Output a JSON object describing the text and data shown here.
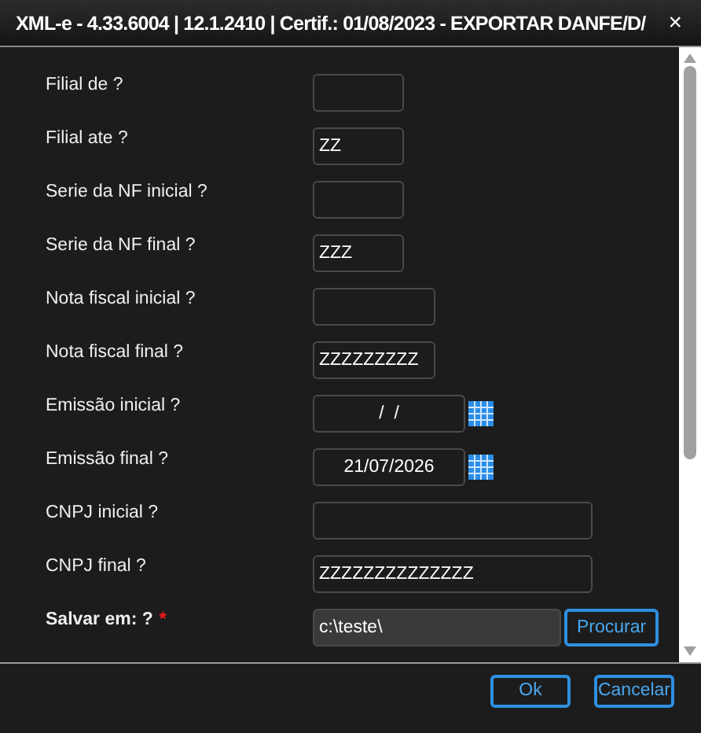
{
  "window": {
    "title": "XML-e - 4.33.6004 | 12.1.2410 | Certif.: 01/08/2023 - EXPORTAR DANFE/D/",
    "close": "×"
  },
  "fields": [
    {
      "label": "Filial de ?",
      "kind": "short"
    },
    {
      "label": "Filial ate ?",
      "kind": "short",
      "value": "ZZ"
    },
    {
      "label": "Serie da NF inicial ?",
      "kind": "short"
    },
    {
      "label": "Serie da NF final ?",
      "kind": "short",
      "value": "ZZZ"
    },
    {
      "label": "Nota fiscal inicial ?",
      "kind": "medium"
    },
    {
      "label": "Nota fiscal final ?",
      "kind": "medium",
      "value": "ZZZZZZZZZ"
    },
    {
      "label": "Emissão inicial ?",
      "kind": "date",
      "value": "/  /"
    },
    {
      "label": "Emissão final ?",
      "kind": "date",
      "value": "21/07/2026"
    },
    {
      "label": "CNPJ inicial ?",
      "kind": "long"
    },
    {
      "label": "CNPJ final ?",
      "kind": "long",
      "value": "ZZZZZZZZZZZZZZ"
    },
    {
      "label": "Salvar em: ?",
      "kind": "folder",
      "value": "c:\\teste\\",
      "required": true,
      "mark": "*",
      "button": "Procurar"
    }
  ],
  "buttons": [
    "Ok",
    "Cancelar"
  ]
}
